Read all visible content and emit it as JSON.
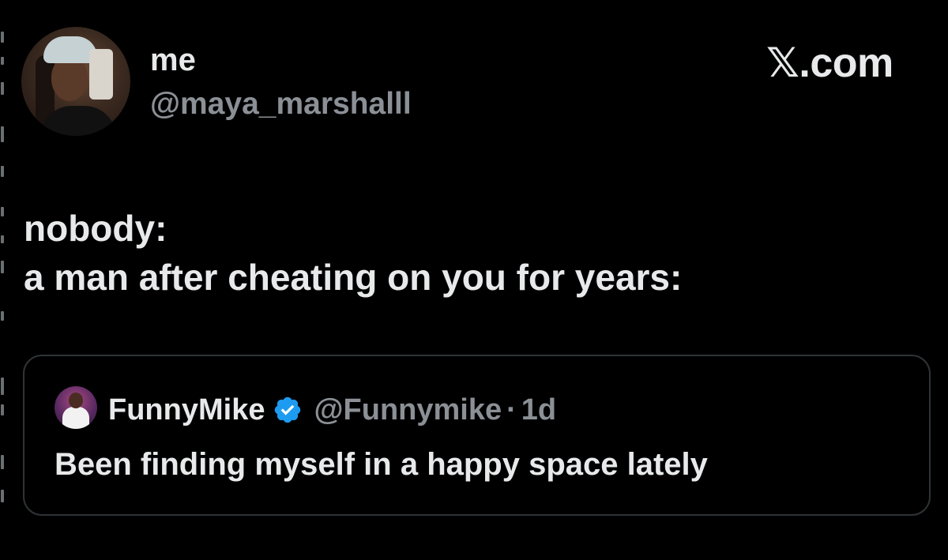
{
  "tweet": {
    "author": {
      "display_name": "me",
      "handle": "@maya_marshalll"
    },
    "brand": "𝕏.com",
    "text_lines": [
      "nobody:",
      "a man after cheating on you for years:"
    ]
  },
  "quoted_tweet": {
    "author": {
      "display_name": "FunnyMike",
      "handle": "@Funnymike",
      "verified": true
    },
    "separator": "·",
    "time": "1d",
    "text": "Been finding myself in a happy space lately"
  },
  "colors": {
    "background": "#000000",
    "primary_text": "#e7e9ea",
    "secondary_text": "#8b9096",
    "card_border": "#2f3336",
    "verified_blue": "#1d9bf0"
  },
  "icons": {
    "verified": "verified-badge-icon"
  }
}
